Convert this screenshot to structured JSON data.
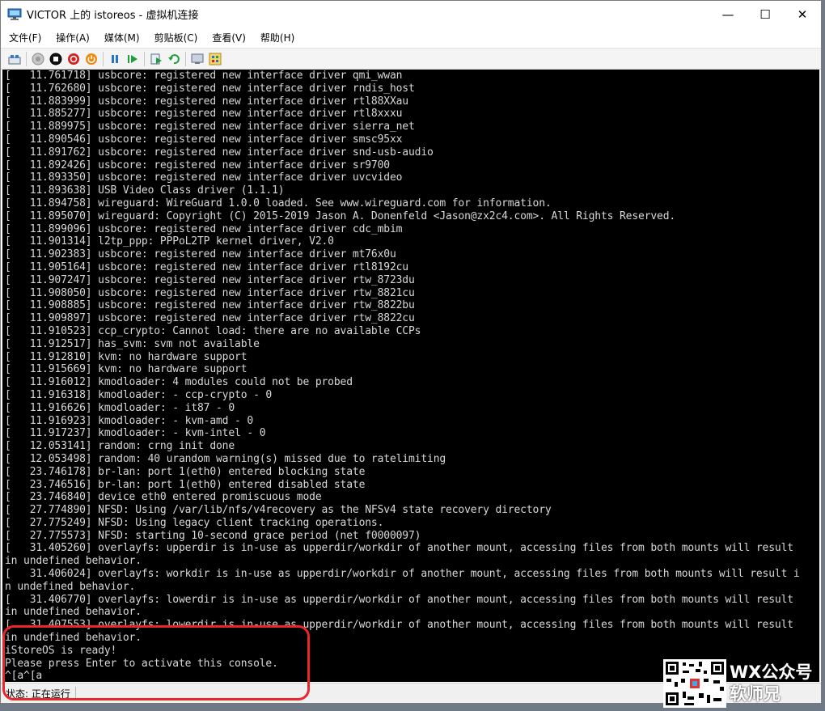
{
  "window": {
    "title": "VICTOR 上的 istoreos - 虚拟机连接",
    "controls": {
      "minimize": "—",
      "maximize": "☐",
      "close": "✕"
    }
  },
  "menu": {
    "items": [
      "文件(F)",
      "操作(A)",
      "媒体(M)",
      "剪贴板(C)",
      "查看(V)",
      "帮助(H)"
    ]
  },
  "toolbar": {
    "icons": [
      "ctrl-alt-del-icon",
      "start-icon",
      "turn-off-icon",
      "shutdown-icon",
      "power-icon",
      "pause-icon",
      "resume-icon",
      "checkpoint-icon",
      "revert-icon",
      "enhanced-session-icon",
      "share-icon"
    ]
  },
  "console": {
    "lines": [
      "[   11.761718] usbcore: registered new interface driver qmi_wwan",
      "[   11.762680] usbcore: registered new interface driver rndis_host",
      "[   11.883999] usbcore: registered new interface driver rtl88XXau",
      "[   11.885277] usbcore: registered new interface driver rtl8xxxu",
      "[   11.889975] usbcore: registered new interface driver sierra_net",
      "[   11.890546] usbcore: registered new interface driver smsc95xx",
      "[   11.891762] usbcore: registered new interface driver snd-usb-audio",
      "[   11.892426] usbcore: registered new interface driver sr9700",
      "[   11.893350] usbcore: registered new interface driver uvcvideo",
      "[   11.893638] USB Video Class driver (1.1.1)",
      "[   11.894758] wireguard: WireGuard 1.0.0 loaded. See www.wireguard.com for information.",
      "[   11.895070] wireguard: Copyright (C) 2015-2019 Jason A. Donenfeld <Jason@zx2c4.com>. All Rights Reserved.",
      "[   11.899096] usbcore: registered new interface driver cdc_mbim",
      "[   11.901314] l2tp_ppp: PPPoL2TP kernel driver, V2.0",
      "[   11.902383] usbcore: registered new interface driver mt76x0u",
      "[   11.905164] usbcore: registered new interface driver rtl8192cu",
      "[   11.907247] usbcore: registered new interface driver rtw_8723du",
      "[   11.908050] usbcore: registered new interface driver rtw_8821cu",
      "[   11.908885] usbcore: registered new interface driver rtw_8822bu",
      "[   11.909897] usbcore: registered new interface driver rtw_8822cu",
      "[   11.910523] ccp_crypto: Cannot load: there are no available CCPs",
      "[   11.912517] has_svm: svm not available",
      "[   11.912810] kvm: no hardware support",
      "[   11.915669] kvm: no hardware support",
      "[   11.916012] kmodloader: 4 modules could not be probed",
      "[   11.916318] kmodloader: - ccp-crypto - 0",
      "[   11.916626] kmodloader: - it87 - 0",
      "[   11.916923] kmodloader: - kvm-amd - 0",
      "[   11.917237] kmodloader: - kvm-intel - 0",
      "[   12.053141] random: crng init done",
      "[   12.053498] random: 40 urandom warning(s) missed due to ratelimiting",
      "[   23.746178] br-lan: port 1(eth0) entered blocking state",
      "[   23.746516] br-lan: port 1(eth0) entered disabled state",
      "[   23.746840] device eth0 entered promiscuous mode",
      "[   27.774890] NFSD: Using /var/lib/nfs/v4recovery as the NFSv4 state recovery directory",
      "[   27.775249] NFSD: Using legacy client tracking operations.",
      "[   27.775573] NFSD: starting 10-second grace period (net f0000097)",
      "[   31.405260] overlayfs: upperdir is in-use as upperdir/workdir of another mount, accessing files from both mounts will result",
      "in undefined behavior.",
      "[   31.406024] overlayfs: workdir is in-use as upperdir/workdir of another mount, accessing files from both mounts will result i",
      "n undefined behavior.",
      "[   31.406770] overlayfs: lowerdir is in-use as upperdir/workdir of another mount, accessing files from both mounts will result",
      "in undefined behavior.",
      "[   31.407553] overlayfs: lowerdir is in-use as upperdir/workdir of another mount, accessing files from both mounts will result",
      "in undefined behavior.",
      "iStoreOS is ready!",
      "Please press Enter to activate this console.",
      "^[a^[a"
    ]
  },
  "status": {
    "text": "状态: 正在运行"
  },
  "watermark": {
    "line1": "WX公众号",
    "line2": "软师兄"
  },
  "colors": {
    "highlight": "#e8262b",
    "console_bg": "#000000",
    "console_fg": "#d8d8d8"
  }
}
